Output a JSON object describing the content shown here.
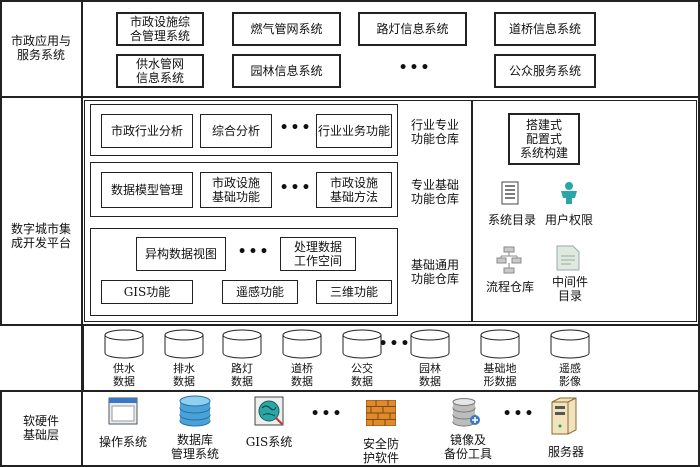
{
  "layers": {
    "app": "市政应用与\n服务系统",
    "platform": "数字城市集\n成开发平台",
    "base": "软硬件\n基础层"
  },
  "app_systems": {
    "row1": [
      "市政设施综\n合管理系统",
      "燃气管网系统",
      "路灯信息系统",
      "道桥信息系统"
    ],
    "row2": [
      "供水管网\n信息系统",
      "园林信息系统",
      "公众服务系统"
    ],
    "ellipsis": "•••"
  },
  "industry_repo": {
    "items": [
      "市政行业分析",
      "综合分析",
      "行业业务功能"
    ],
    "label": "行业专业\n功能仓库",
    "ellipsis": "•••"
  },
  "special_repo": {
    "items": [
      "数据模型管理",
      "市政设施\n基础功能",
      "市政设施\n基础方法"
    ],
    "label": "专业基础\n功能仓库",
    "ellipsis": "•••"
  },
  "common_repo": {
    "items": [
      "异构数据视图",
      "处理数据\n工作空间",
      "GIS功能",
      "遥感功能",
      "三维功能"
    ],
    "label": "基础通用\n功能仓库",
    "ellipsis": "•••"
  },
  "builder": {
    "title": "搭建式\n配置式\n系统构建",
    "tools": [
      {
        "label": "系统目录",
        "icon": "document-list-icon"
      },
      {
        "label": "用户权限",
        "icon": "user-icon"
      },
      {
        "label": "流程仓库",
        "icon": "flowchart-icon"
      },
      {
        "label": "中间件\n目录",
        "icon": "middleware-icon"
      }
    ]
  },
  "databases": {
    "items": [
      "供水\n数据",
      "排水\n数据",
      "路灯\n数据",
      "道桥\n数据",
      "公交\n数据",
      "园林\n数据",
      "基础地\n形数据",
      "遥感\n影像"
    ],
    "ellipsis": "•••"
  },
  "base_items": {
    "items": [
      {
        "label": "操作系统",
        "icon": "window-icon"
      },
      {
        "label": "数据库\n管理系统",
        "icon": "database-stack-icon"
      },
      {
        "label": "GIS系统",
        "icon": "gis-globe-icon"
      },
      {
        "label": "安全防\n护软件",
        "icon": "firewall-icon"
      },
      {
        "label": "镜像及\n备份工具",
        "icon": "backup-icon"
      },
      {
        "label": "服务器",
        "icon": "server-icon"
      }
    ],
    "ellipsis": "•••"
  },
  "colors": {
    "line": "#222222",
    "icon_blue": "#3a78c2",
    "icon_teal": "#2aa6a6",
    "icon_gray": "#8a8a8a",
    "icon_orange": "#e08a2a"
  }
}
